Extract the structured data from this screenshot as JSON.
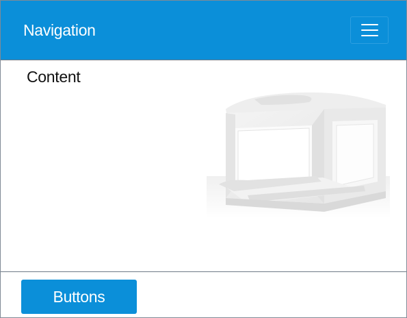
{
  "navbar": {
    "title": "Navigation",
    "menu_icon": "hamburger-menu-icon",
    "background_color": "#0b8fd9"
  },
  "content": {
    "label": "Content",
    "image_subject": "3d-printer"
  },
  "footer": {
    "button_label": "Buttons",
    "button_color": "#0b8fd9"
  }
}
